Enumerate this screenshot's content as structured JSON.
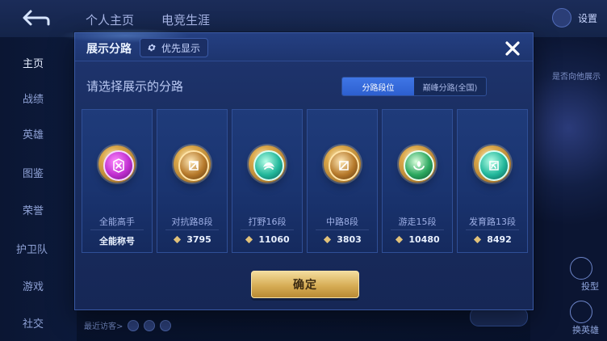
{
  "background": {
    "top_tabs": [
      "个人主页",
      "电竞生涯"
    ],
    "settings_label": "设置",
    "sidebar_items": [
      "主页",
      "战绩",
      "英雄",
      "图鉴",
      "荣誉",
      "护卫队",
      "游戏",
      "社交"
    ],
    "right_panel_text": "是否向他展示",
    "right_labels": [
      "投型",
      "换英雄"
    ],
    "recent_visitors_label": "最近访客>"
  },
  "modal": {
    "title": "展示分路",
    "pref_button_label": "优先显示",
    "prompt": "请选择展示的分路",
    "switch": {
      "options": [
        "分路段位",
        "巅峰分路(全国)"
      ],
      "active_index": 0
    },
    "cards": [
      {
        "rank": "全能高手",
        "stat_text": "全能称号",
        "badge_style": "purple",
        "icon": "allrounder-emblem-icon"
      },
      {
        "rank": "对抗路8段",
        "stat_value": "3795",
        "badge_style": "gold",
        "icon": "clash-lane-emblem-icon"
      },
      {
        "rank": "打野16段",
        "stat_value": "11060",
        "badge_style": "teal",
        "icon": "jungle-emblem-icon"
      },
      {
        "rank": "中路8段",
        "stat_value": "3803",
        "badge_style": "gold",
        "icon": "mid-lane-emblem-icon"
      },
      {
        "rank": "游走15段",
        "stat_value": "10480",
        "badge_style": "green",
        "icon": "roam-emblem-icon"
      },
      {
        "rank": "发育路13段",
        "stat_value": "8492",
        "badge_style": "teal",
        "icon": "farm-lane-emblem-icon"
      }
    ],
    "confirm_label": "确定"
  },
  "colors": {
    "accent_blue": "#2d5fcf",
    "confirm_gold": "#d7ad55",
    "panel_bg": "#1a2e61"
  }
}
